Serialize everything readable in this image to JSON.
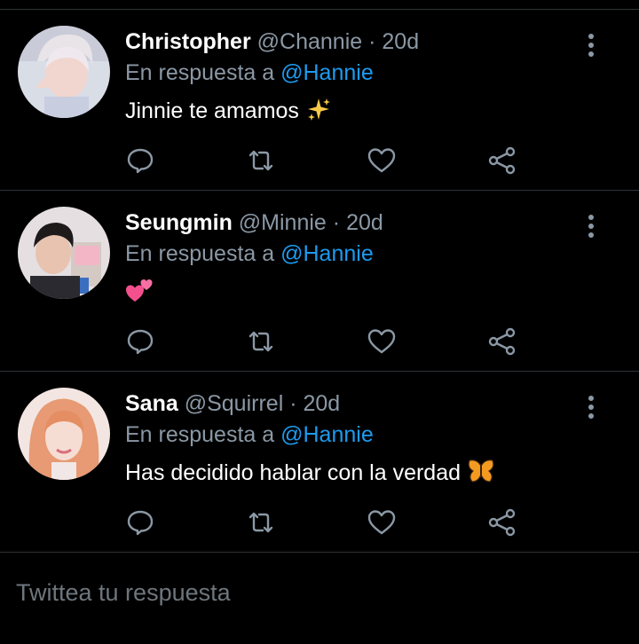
{
  "replies": [
    {
      "name": "Christopher",
      "handle": "@Channie",
      "separator": "·",
      "time": "20d",
      "reply_prefix": "En respuesta a",
      "reply_to": "@Hannie",
      "text": "Jinnie te amamos",
      "emoji": "sparkles-icon"
    },
    {
      "name": "Seungmin",
      "handle": "@Minnie",
      "separator": "·",
      "time": "20d",
      "reply_prefix": "En respuesta a",
      "reply_to": "@Hannie",
      "text": "",
      "emoji": "two-hearts-icon"
    },
    {
      "name": "Sana",
      "handle": "@Squirrel",
      "separator": "·",
      "time": "20d",
      "reply_prefix": "En respuesta a",
      "reply_to": "@Hannie",
      "text": "Has decidido hablar con la verdad",
      "emoji": "butterfly-icon"
    }
  ],
  "composer": {
    "placeholder": "Twittea tu respuesta"
  },
  "colors": {
    "background": "#000000",
    "muted": "#8b98a5",
    "link": "#1d9bf0",
    "divider": "#2f3336"
  }
}
